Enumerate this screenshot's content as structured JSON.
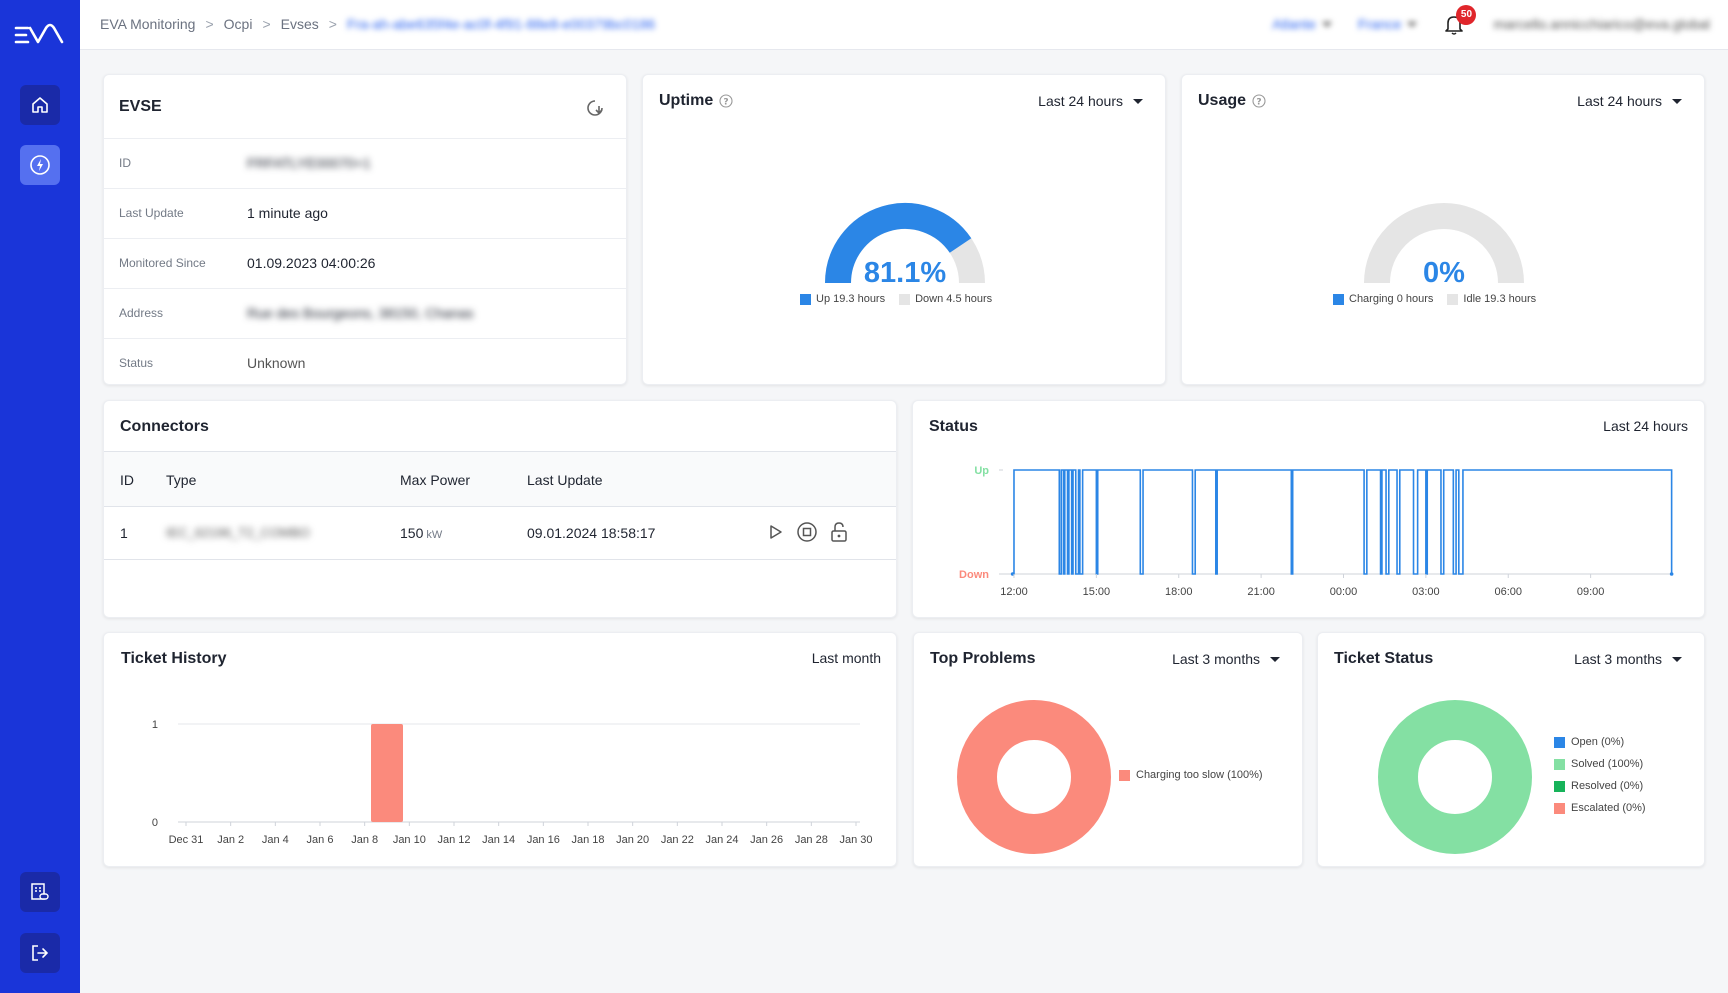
{
  "breadcrumb": {
    "root": "EVA Monitoring",
    "level1": "Ocpi",
    "level2": "Evses",
    "current": "Fra-ah-abe635f4e-ac0f-4f91-88e8-e00379bc0186"
  },
  "topbar": {
    "org": "Atlante",
    "country": "France",
    "notifications": "50",
    "user": "marcello.annicchiarico@eva.global"
  },
  "evse": {
    "title": "EVSE",
    "rows": [
      {
        "label": "ID",
        "value": "FRFATLYE00070+1"
      },
      {
        "label": "Last Update",
        "value": "1 minute ago"
      },
      {
        "label": "Monitored Since",
        "value": "01.09.2023 04:00:26"
      },
      {
        "label": "Address",
        "value": "Rue des Bourgeons, 38150, Chanas"
      },
      {
        "label": "Status",
        "value": "Unknown"
      }
    ]
  },
  "uptime": {
    "title": "Uptime",
    "range": "Last 24 hours",
    "value": "81.1%",
    "fraction": 0.811,
    "legend": [
      {
        "label": "Up 19.3 hours",
        "color": "#2b86e6"
      },
      {
        "label": "Down 4.5 hours",
        "color": "#e5e5e5"
      }
    ]
  },
  "usage": {
    "title": "Usage",
    "range": "Last 24 hours",
    "value": "0%",
    "fraction": 0,
    "legend": [
      {
        "label": "Charging 0 hours",
        "color": "#2b86e6"
      },
      {
        "label": "Idle 19.3 hours",
        "color": "#e5e5e5"
      }
    ]
  },
  "connectors": {
    "title": "Connectors",
    "headers": {
      "id": "ID",
      "type": "Type",
      "max_power": "Max Power",
      "last_update": "Last Update"
    },
    "rows": [
      {
        "id": "1",
        "type": "IEC_62196_T2_COMBO",
        "power": "150",
        "unit": "kW",
        "last_update": "09.01.2024 18:58:17"
      }
    ]
  },
  "status": {
    "title": "Status",
    "range": "Last 24 hours"
  },
  "ticket_history": {
    "title": "Ticket History",
    "range": "Last month"
  },
  "top_problems": {
    "title": "Top Problems",
    "range": "Last 3 months",
    "legend": [
      {
        "label": "Charging too slow (100%)",
        "color": "#fb8a7c"
      }
    ]
  },
  "ticket_status": {
    "title": "Ticket Status",
    "range": "Last 3 months",
    "legend": [
      {
        "label": "Open (0%)",
        "color": "#2b86e6"
      },
      {
        "label": "Solved (100%)",
        "color": "#84e0a3"
      },
      {
        "label": "Resolved (0%)",
        "color": "#17b35a"
      },
      {
        "label": "Escalated (0%)",
        "color": "#fb8a7c"
      }
    ]
  },
  "chart_data": [
    {
      "type": "line",
      "title": "Status",
      "y_categories": [
        "Down",
        "Up"
      ],
      "x_ticks": [
        "12:00",
        "15:00",
        "18:00",
        "21:00",
        "00:00",
        "03:00",
        "06:00",
        "09:00"
      ],
      "x_hours": [
        11.95,
        12.0,
        13.65,
        13.72,
        13.8,
        13.85,
        13.95,
        14.0,
        14.1,
        14.15,
        14.25,
        14.35,
        14.4,
        14.5,
        15.0,
        15.05,
        16.6,
        16.7,
        18.5,
        18.6,
        19.35,
        19.4,
        22.1,
        22.15,
        24.75,
        24.85,
        25.35,
        25.4,
        25.55,
        25.65,
        25.95,
        26.05,
        26.55,
        26.7,
        27.0,
        27.05,
        27.55,
        27.65,
        28.0,
        28.1,
        28.2,
        28.35,
        35.95
      ],
      "y_states": [
        0,
        1,
        0,
        1,
        0,
        1,
        0,
        1,
        0,
        1,
        0,
        1,
        0,
        1,
        0,
        1,
        0,
        1,
        0,
        1,
        0,
        1,
        0,
        1,
        0,
        1,
        0,
        1,
        0,
        1,
        0,
        1,
        0,
        1,
        0,
        1,
        0,
        1,
        0,
        1,
        0,
        1,
        0
      ],
      "legend": "none"
    },
    {
      "type": "bar",
      "title": "Ticket History",
      "categories": [
        "Dec 31",
        "Jan 2",
        "Jan 4",
        "Jan 6",
        "Jan 8",
        "Jan 10",
        "Jan 12",
        "Jan 14",
        "Jan 16",
        "Jan 18",
        "Jan 20",
        "Jan 22",
        "Jan 24",
        "Jan 26",
        "Jan 28",
        "Jan 30"
      ],
      "bar_date_index": 4.5,
      "bar_value": 1,
      "y_ticks": [
        "0",
        "1"
      ],
      "ylim": [
        0,
        1
      ]
    },
    {
      "type": "pie",
      "title": "Top Problems",
      "labels": [
        "Charging too slow"
      ],
      "values": [
        100
      ]
    },
    {
      "type": "pie",
      "title": "Ticket Status",
      "labels": [
        "Open",
        "Solved",
        "Resolved",
        "Escalated"
      ],
      "values": [
        0,
        100,
        0,
        0
      ]
    }
  ]
}
